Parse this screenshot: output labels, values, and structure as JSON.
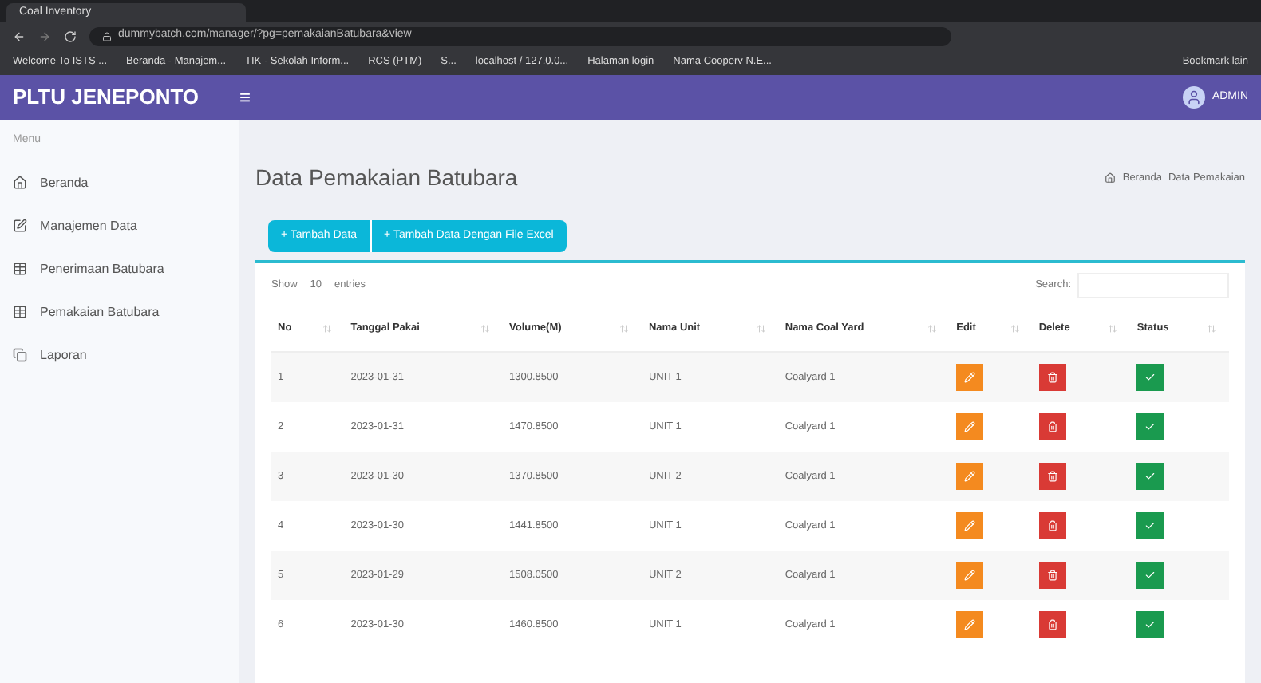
{
  "browser": {
    "tab_title": "Coal Inventory",
    "url": "dummybatch.com/manager/?pg=pemakaianBatubara&view",
    "bookmarks": [
      "Welcome To ISTS ...",
      "Beranda - Manajem...",
      "TIK - Sekolah Inform...",
      "RCS (PTM)",
      "S...",
      "localhost / 127.0.0...",
      "Halaman login",
      "Nama Cooperv N.E..."
    ],
    "other_bookmarks": "Bookmark lain"
  },
  "header": {
    "brand": "PLTU JENEPONTO",
    "menu_icon": "≡",
    "user": "ADMIN"
  },
  "sidebar": {
    "section": "Menu",
    "items": [
      {
        "label": "Beranda"
      },
      {
        "label": "Manajemen Data"
      },
      {
        "label": "Penerimaan Batubara"
      },
      {
        "label": "Pemakaian Batubara"
      },
      {
        "label": "Laporan"
      }
    ]
  },
  "page": {
    "title": "Data Pemakaian Batubara",
    "breadcrumb": [
      "Beranda",
      "Data Pemakaian"
    ],
    "buttons": [
      "+ Tambah Data",
      "+ Tambah Data Dengan File Excel"
    ]
  },
  "table": {
    "show_label": "Show",
    "page_size": "10",
    "entries_label": "entries",
    "search_label": "Search:",
    "columns": [
      "No",
      "Tanggal Pakai",
      "Volume(M)",
      "Nama Unit",
      "Nama Coal Yard",
      "Edit",
      "Delete",
      "Status"
    ],
    "rows": [
      {
        "no": "1",
        "date": "2023-01-31",
        "volume": "1300.8500",
        "unit": "UNIT 1",
        "yard": "Coalyard 1"
      },
      {
        "no": "2",
        "date": "2023-01-31",
        "volume": "1470.8500",
        "unit": "UNIT 1",
        "yard": "Coalyard 1"
      },
      {
        "no": "3",
        "date": "2023-01-30",
        "volume": "1370.8500",
        "unit": "UNIT 2",
        "yard": "Coalyard 1"
      },
      {
        "no": "4",
        "date": "2023-01-30",
        "volume": "1441.8500",
        "unit": "UNIT 1",
        "yard": "Coalyard 1"
      },
      {
        "no": "5",
        "date": "2023-01-29",
        "volume": "1508.0500",
        "unit": "UNIT 2",
        "yard": "Coalyard 1"
      },
      {
        "no": "6",
        "date": "2023-01-30",
        "volume": "1460.8500",
        "unit": "UNIT 1",
        "yard": "Coalyard 1"
      }
    ]
  }
}
